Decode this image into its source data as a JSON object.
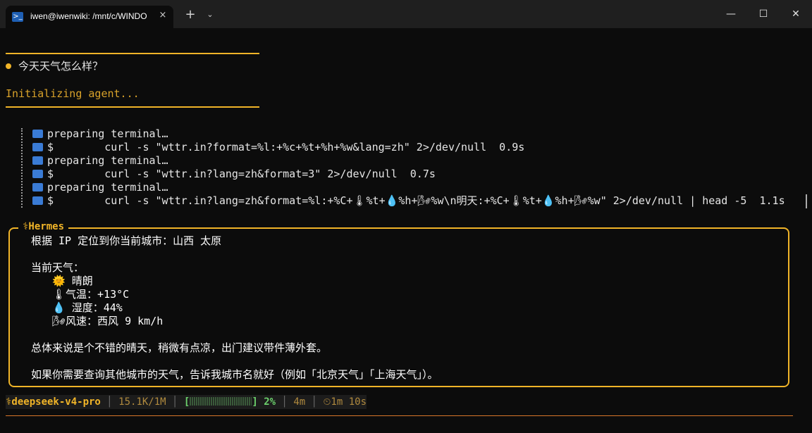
{
  "window": {
    "tab_title": "iwen@iwenwiki: /mnt/c/WINDOWS",
    "tab_icon": "terminal-icon",
    "close_tab": "×",
    "new_tab": "+",
    "dropdown": "⌄",
    "minimize": "—",
    "maximize": "☐",
    "close": "✕"
  },
  "prompt": {
    "question": "今天天气怎么样？",
    "status": "Initializing agent..."
  },
  "tool_calls": [
    {
      "text": "preparing terminal…"
    },
    {
      "text": "$        curl -s \"wttr.in?format=%l:+%c+%t+%h+%w&lang=zh\" 2>/dev/null  0.9s"
    },
    {
      "text": "preparing terminal…"
    },
    {
      "text": "$        curl -s \"wttr.in?lang=zh&format=3\" 2>/dev/null  0.7s"
    },
    {
      "text": "preparing terminal…"
    },
    {
      "text": "$        curl -s \"wttr.in?lang=zh&format=%l:+%C+🌡%t+💧%h+🌬%w\\n明天:+%C+🌡%t+💧%h+🌬%w\" 2>/dev/null | head -5  1.1s"
    }
  ],
  "response": {
    "label": "⚕Hermes",
    "location": "根据 IP 定位到你当前城市：山西 太原",
    "weather_header": "当前天气：",
    "condition": "🌞 晴朗",
    "temperature": "🌡气温：+13°C",
    "humidity": "💧 湿度：44%",
    "wind": "🌬风速：西风 9 km/h",
    "summary": "总体来说是个不错的晴天，稍微有点凉，出门建议带件薄外套。",
    "followup": "如果你需要查询其他城市的天气，告诉我城市名就好（例如「北京天气」「上海天气」）。"
  },
  "status_bar": {
    "model": "⚕deepseek-v4-pro",
    "tokens": "15.1K/1M",
    "bracket_open": "[",
    "bracket_close": "]",
    "percent": "2%",
    "progress": 0.02,
    "elapsed": "4m",
    "timer": "⏲1m 10s"
  },
  "colors": {
    "accent": "#f0b428",
    "background": "#0c0c0c",
    "progress_green": "#6cd06c"
  }
}
